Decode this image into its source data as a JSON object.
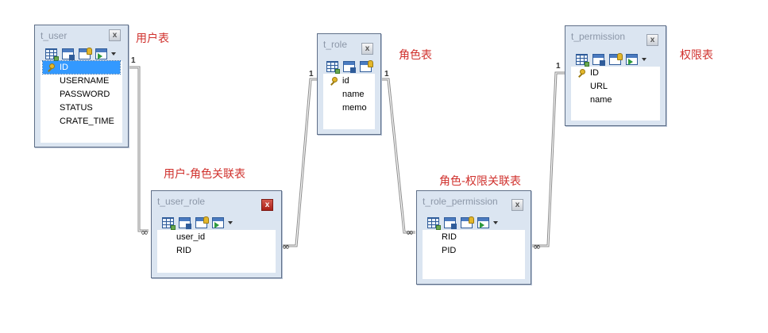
{
  "tables": {
    "t_user": {
      "name": "t_user",
      "close": "x",
      "fields": [
        "ID",
        "USERNAME",
        "PASSWORD",
        "STATUS",
        "CRATE_TIME"
      ]
    },
    "t_role": {
      "name": "t_role",
      "close": "x",
      "fields": [
        "id",
        "name",
        "memo"
      ]
    },
    "t_permission": {
      "name": "t_permission",
      "close": "x",
      "fields": [
        "ID",
        "URL",
        "name"
      ]
    },
    "t_user_role": {
      "name": "t_user_role",
      "close": "x",
      "fields": [
        "user_id",
        "RID"
      ]
    },
    "t_role_permission": {
      "name": "t_role_permission",
      "close": "x",
      "fields": [
        "RID",
        "PID"
      ]
    }
  },
  "labels": {
    "user": "用户表",
    "role": "角色表",
    "permission": "权限表",
    "user_role": "用户-角色关联表",
    "role_permission": "角色-权限关联表"
  },
  "relations": {
    "one": "1",
    "many": "∞"
  },
  "colors": {
    "label": "#d0312d",
    "selected_row": "#3399ff",
    "close_active": "#c0392b",
    "connector": "#808080"
  },
  "icons": [
    "grid-icon",
    "table-icon",
    "key-table-icon",
    "add-field-icon",
    "dropdown-arrow-icon",
    "primary-key-icon",
    "close-icon"
  ]
}
